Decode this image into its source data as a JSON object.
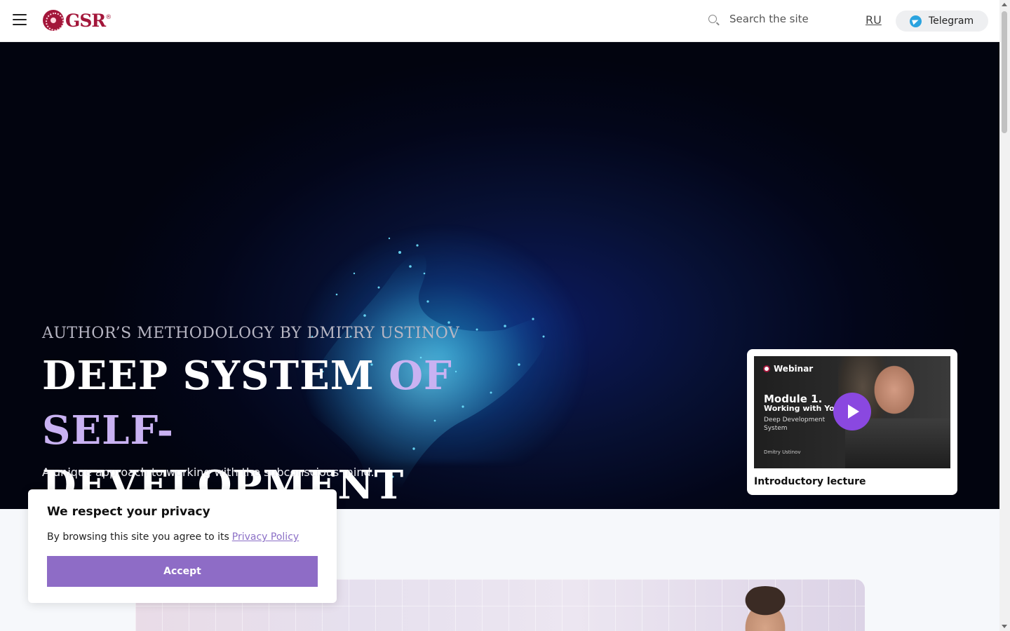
{
  "header": {
    "logo_text": "GSR",
    "logo_mark": "®",
    "search_placeholder": "Search the site",
    "lang_label": "RU",
    "telegram_label": "Telegram"
  },
  "hero": {
    "eyebrow": "AUTHOR’S METHODOLOGY BY DMITRY USTINOV",
    "title_part1": "DEEP SYSTEM ",
    "title_accent": "OF SELF-",
    "title_part2": "DEVELOPMENT",
    "subtitle": "A unique approach to working with the subconscious mind.",
    "webinar": {
      "badge": "Webinar",
      "module": "Module 1.",
      "working": "Working with Yourself",
      "system": "Deep Development System",
      "author": "Dmitry Ustinov",
      "caption": "Introductory lecture"
    }
  },
  "privacy": {
    "title": "We respect your privacy",
    "text": "By browsing this site you agree to its",
    "link": "Privacy Policy",
    "accept": "Accept"
  },
  "colors": {
    "brand": "#a3163a",
    "accent_purple": "#8e6cc6",
    "telegram_blue": "#2aa3df",
    "hero_accent": "#c9b2f2"
  },
  "icons": [
    "hamburger-menu-icon",
    "search-icon",
    "telegram-icon",
    "play-icon",
    "logo-seal-icon"
  ]
}
